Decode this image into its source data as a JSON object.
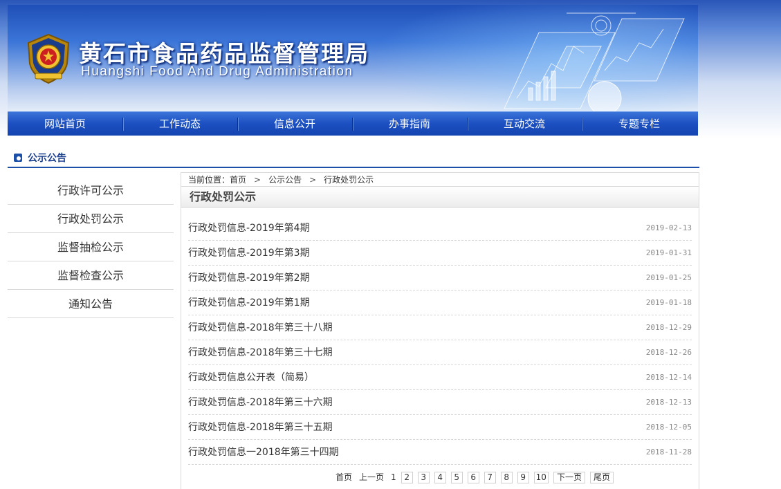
{
  "header": {
    "title": "黄石市食品药品监督管理局",
    "subtitle": "Huangshi Food And Drug Administration",
    "emblem_icon": "national-emblem-icon"
  },
  "nav": {
    "items": [
      {
        "label": "网站首页"
      },
      {
        "label": "工作动态"
      },
      {
        "label": "信息公开"
      },
      {
        "label": "办事指南"
      },
      {
        "label": "互动交流"
      },
      {
        "label": "专题专栏"
      }
    ]
  },
  "section": {
    "title": "公示公告",
    "icon": "bullet-icon"
  },
  "sidebar": {
    "items": [
      {
        "label": "行政许可公示"
      },
      {
        "label": "行政处罚公示"
      },
      {
        "label": "监督抽检公示"
      },
      {
        "label": "监督检查公示"
      },
      {
        "label": "通知公告"
      }
    ]
  },
  "breadcrumb": {
    "prefix": "当前位置：",
    "items": [
      "首页",
      "公示公告",
      "行政处罚公示"
    ],
    "separator": ">"
  },
  "content": {
    "title": "行政处罚公示",
    "rows": [
      {
        "title": "行政处罚信息-2019年第4期",
        "date": "2019-02-13"
      },
      {
        "title": "行政处罚信息-2019年第3期",
        "date": "2019-01-31"
      },
      {
        "title": "行政处罚信息-2019年第2期",
        "date": "2019-01-25"
      },
      {
        "title": "行政处罚信息-2019年第1期",
        "date": "2019-01-18"
      },
      {
        "title": "行政处罚信息-2018年第三十八期",
        "date": "2018-12-29"
      },
      {
        "title": "行政处罚信息-2018年第三十七期",
        "date": "2018-12-26"
      },
      {
        "title": "行政处罚信息公开表（简易）",
        "date": "2018-12-14"
      },
      {
        "title": "行政处罚信息-2018年第三十六期",
        "date": "2018-12-13"
      },
      {
        "title": "行政处罚信息-2018年第三十五期",
        "date": "2018-12-05"
      },
      {
        "title": "行政处罚信息一2018年第三十四期",
        "date": "2018-11-28"
      }
    ]
  },
  "pager": {
    "first": "首页",
    "prev": "上一页",
    "current": "1",
    "pages": [
      "2",
      "3",
      "4",
      "5",
      "6",
      "7",
      "8",
      "9",
      "10"
    ],
    "next": "下一页",
    "last": "尾页"
  },
  "colors": {
    "nav_blue": "#1c4fc0",
    "accent_blue": "#1c4fa8"
  }
}
